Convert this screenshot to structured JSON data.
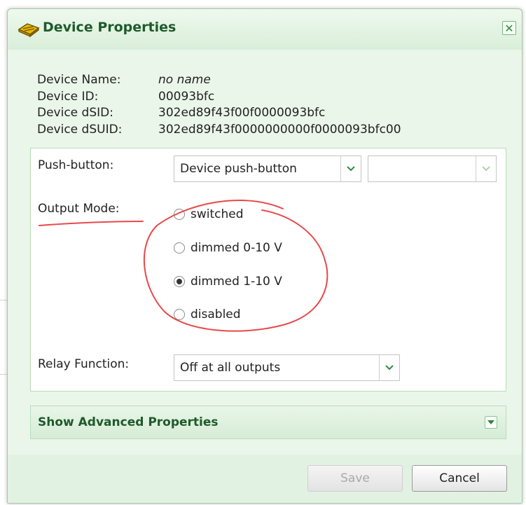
{
  "dialog": {
    "title": "Device Properties",
    "close_icon": "close-icon",
    "title_icon": "device-icon"
  },
  "info": {
    "rows": [
      {
        "label": "Device Name:",
        "value": "no name"
      },
      {
        "label": "Device ID:",
        "value": "00093bfc"
      },
      {
        "label": "Device dSID:",
        "value": "302ed89f43f00f0000093bfc"
      },
      {
        "label": "Device dSUID:",
        "value": "302ed89f43f0000000000f0000093bfc00"
      }
    ]
  },
  "push_button": {
    "label": "Push-button:",
    "selected": "Device push-button",
    "second_selected": ""
  },
  "output_mode": {
    "label": "Output Mode:",
    "options": [
      {
        "label": "switched",
        "checked": false
      },
      {
        "label": "dimmed 0-10 V",
        "checked": false
      },
      {
        "label": "dimmed 1-10 V",
        "checked": true
      },
      {
        "label": "disabled",
        "checked": false
      }
    ]
  },
  "relay_function": {
    "label": "Relay Function:",
    "selected": "Off at all outputs"
  },
  "advanced": {
    "label": "Show Advanced Properties"
  },
  "buttons": {
    "save": "Save",
    "cancel": "Cancel"
  },
  "colors": {
    "accent": "#1f5a2b",
    "annotation": "#e8484a"
  }
}
